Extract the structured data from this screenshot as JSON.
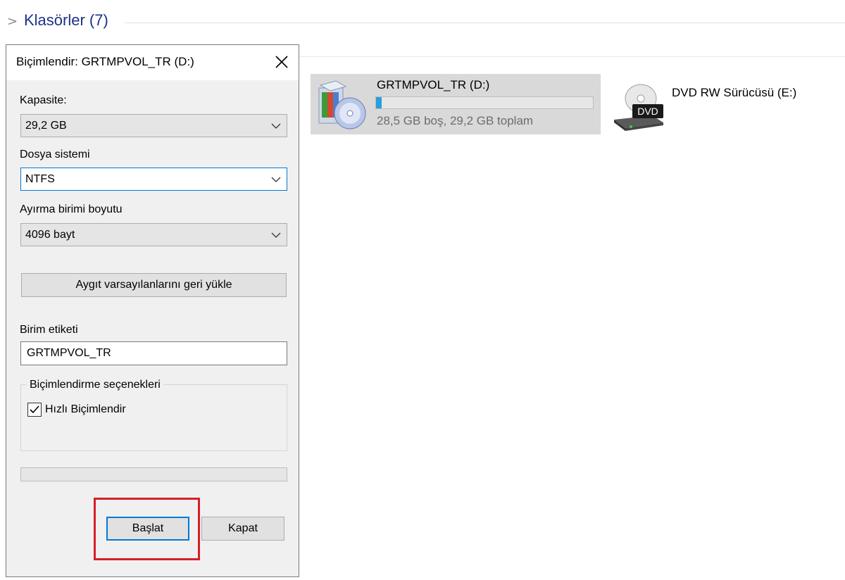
{
  "explorer": {
    "section_title": "Klasörler (7)",
    "drive": {
      "name": "GRTMPVOL_TR (D:)",
      "size_text": "28,5 GB boş, 29,2 GB toplam",
      "used_fraction": 0.025
    },
    "dvd": {
      "name": "DVD RW Sürücüsü (E:)",
      "badge": "DVD"
    }
  },
  "dialog": {
    "title": "Biçimlendir: GRTMPVOL_TR (D:)",
    "capacity_label": "Kapasite:",
    "capacity_value": "29,2 GB",
    "filesystem_label": "Dosya sistemi",
    "filesystem_value": "NTFS",
    "allocation_label": "Ayırma birimi boyutu",
    "allocation_value": "4096 bayt",
    "restore_defaults_label": "Aygıt varsayılanlarını geri yükle",
    "volume_label_label": "Birim etiketi",
    "volume_label_value": "GRTMPVOL_TR",
    "options_group_title": "Biçimlendirme seçenekleri",
    "quick_format_label": "Hızlı Biçimlendir",
    "quick_format_checked": true,
    "start_label": "Başlat",
    "close_label": "Kapat"
  },
  "colors": {
    "accent": "#0078d7",
    "highlight": "#d61f26",
    "drive_bar": "#26a0da"
  }
}
